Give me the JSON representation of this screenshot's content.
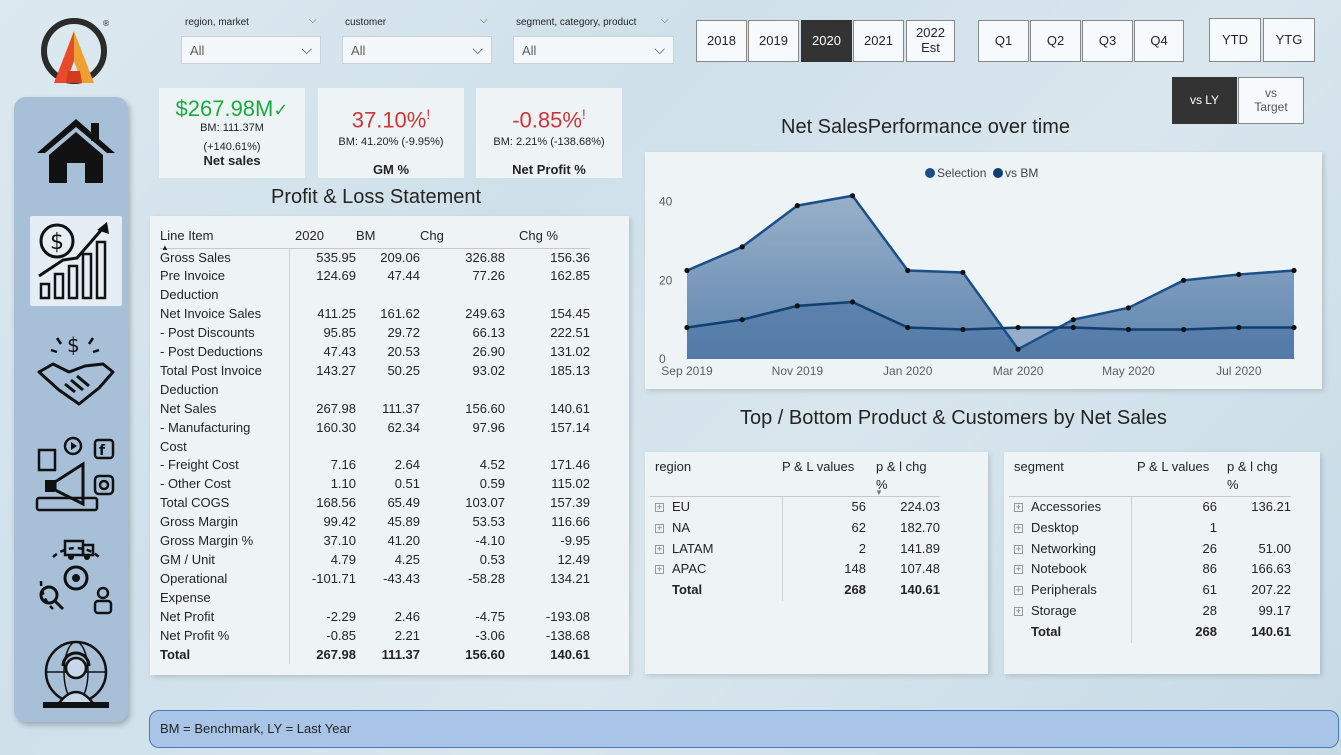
{
  "filters": {
    "region": {
      "label": "region, market",
      "value": "All"
    },
    "customer": {
      "label": "customer",
      "value": "All"
    },
    "segment": {
      "label": "segment, category, product",
      "value": "All"
    }
  },
  "years": [
    {
      "label": "2018",
      "sub": ""
    },
    {
      "label": "2019",
      "sub": ""
    },
    {
      "label": "2020",
      "sub": ""
    },
    {
      "label": "2021",
      "sub": ""
    },
    {
      "label": "2022",
      "sub": "Est"
    }
  ],
  "quarters": [
    "Q1",
    "Q2",
    "Q3",
    "Q4"
  ],
  "periods": [
    "YTD",
    "YTG"
  ],
  "compare": {
    "vs_ly": "vs LY",
    "vs_target_1": "vs",
    "vs_target_2": "Target"
  },
  "kpis": {
    "net_sales": {
      "value": "$267.98M",
      "mark": "✓",
      "bm": "BM: 111.37M",
      "chg": "(+140.61%)",
      "label": "Net sales"
    },
    "gm": {
      "value": "37.10%",
      "mark": "!",
      "bm": "BM: 41.20% (-9.95%)",
      "label": "GM %"
    },
    "np": {
      "value": "-0.85%",
      "mark": "!",
      "bm": "BM: 2.21% (-138.68%)",
      "label": "Net Profit %"
    }
  },
  "titles": {
    "pl": "Profit & Loss Statement",
    "chart": "Net SalesPerformance over time",
    "topbottom": "Top / Bottom Product & Customers by Net Sales"
  },
  "pl": {
    "headers": [
      "Line Item",
      "2020",
      "BM",
      "Chg",
      "Chg %"
    ],
    "rows": [
      {
        "l1": "Gross Sales",
        "l2": "",
        "v": [
          "535.95",
          "209.06",
          "326.88",
          "156.36"
        ]
      },
      {
        "l1": "Pre Invoice",
        "l2": "Deduction",
        "v": [
          "124.69",
          "47.44",
          "77.26",
          "162.85"
        ]
      },
      {
        "l1": "Net Invoice Sales",
        "l2": "",
        "v": [
          "411.25",
          "161.62",
          "249.63",
          "154.45"
        ]
      },
      {
        "l1": "- Post Discounts",
        "l2": "",
        "v": [
          "95.85",
          "29.72",
          "66.13",
          "222.51"
        ]
      },
      {
        "l1": "- Post Deductions",
        "l2": "",
        "v": [
          "47.43",
          "20.53",
          "26.90",
          "131.02"
        ]
      },
      {
        "l1": "Total Post Invoice",
        "l2": "Deduction",
        "v": [
          "143.27",
          "50.25",
          "93.02",
          "185.13"
        ]
      },
      {
        "l1": "Net Sales",
        "l2": "",
        "v": [
          "267.98",
          "111.37",
          "156.60",
          "140.61"
        ]
      },
      {
        "l1": "- Manufacturing",
        "l2": "Cost",
        "v": [
          "160.30",
          "62.34",
          "97.96",
          "157.14"
        ]
      },
      {
        "l1": "- Freight Cost",
        "l2": "",
        "v": [
          "7.16",
          "2.64",
          "4.52",
          "171.46"
        ]
      },
      {
        "l1": "- Other Cost",
        "l2": "",
        "v": [
          "1.10",
          "0.51",
          "0.59",
          "115.02"
        ]
      },
      {
        "l1": "Total COGS",
        "l2": "",
        "v": [
          "168.56",
          "65.49",
          "103.07",
          "157.39"
        ]
      },
      {
        "l1": "Gross Margin",
        "l2": "",
        "v": [
          "99.42",
          "45.89",
          "53.53",
          "116.66"
        ]
      },
      {
        "l1": "Gross Margin %",
        "l2": "",
        "v": [
          "37.10",
          "41.20",
          "-4.10",
          "-9.95"
        ]
      },
      {
        "l1": "GM / Unit",
        "l2": "",
        "v": [
          "4.79",
          "4.25",
          "0.53",
          "12.49"
        ]
      },
      {
        "l1": "Operational",
        "l2": "Expense",
        "v": [
          "-101.71",
          "-43.43",
          "-58.28",
          "134.21"
        ]
      },
      {
        "l1": "Net Profit",
        "l2": "",
        "v": [
          "-2.29",
          "2.46",
          "-4.75",
          "-193.08"
        ]
      },
      {
        "l1": "Net Profit %",
        "l2": "",
        "v": [
          "-0.85",
          "2.21",
          "-3.06",
          "-138.68"
        ]
      }
    ],
    "total": {
      "label": "Total",
      "v": [
        "267.98",
        "111.37",
        "156.60",
        "140.61"
      ]
    }
  },
  "chart_data": {
    "type": "area",
    "title": "Net SalesPerformance over time",
    "legend": [
      "Selection",
      "vs BM"
    ],
    "legend_position": "top-center",
    "x": [
      "Sep 2019",
      "Oct 2019",
      "Nov 2019",
      "Dec 2019",
      "Jan 2020",
      "Feb 2020",
      "Mar 2020",
      "Apr 2020",
      "May 2020",
      "Jun 2020",
      "Jul 2020",
      "Aug 2020"
    ],
    "x_tick_labels": [
      "Sep 2019",
      "Nov 2019",
      "Jan 2020",
      "Mar 2020",
      "May 2020",
      "Jul 2020"
    ],
    "y_ticks": [
      0,
      20,
      40
    ],
    "ylim": [
      0,
      45
    ],
    "series": [
      {
        "name": "Selection",
        "values": [
          22.5,
          28.5,
          39,
          41.5,
          22.5,
          22,
          2.5,
          10,
          13,
          20,
          21.5,
          22.5
        ]
      },
      {
        "name": "vs BM",
        "values": [
          8,
          10,
          13.5,
          14.5,
          8,
          7.5,
          8,
          8,
          7.5,
          7.5,
          8,
          8
        ]
      }
    ],
    "colors": {
      "selection": "#1a4f8a",
      "bm": "#0f3e70",
      "fill_top": "#8fa9c4",
      "fill_bottom": "#4f79a8"
    }
  },
  "region_table": {
    "headers": [
      "region",
      "P & L values",
      "p & l chg",
      "%"
    ],
    "rows": [
      {
        "name": "EU",
        "v1": "56",
        "v2": "224.03"
      },
      {
        "name": "NA",
        "v1": "62",
        "v2": "182.70"
      },
      {
        "name": "LATAM",
        "v1": "2",
        "v2": "141.89"
      },
      {
        "name": "APAC",
        "v1": "148",
        "v2": "107.48"
      }
    ],
    "total": {
      "name": "Total",
      "v1": "268",
      "v2": "140.61"
    }
  },
  "segment_table": {
    "headers": [
      "segment",
      "P & L values",
      "p & l chg",
      "%"
    ],
    "rows": [
      {
        "name": "Accessories",
        "v1": "66",
        "v2": "136.21"
      },
      {
        "name": "Desktop",
        "v1": "1",
        "v2": ""
      },
      {
        "name": "Networking",
        "v1": "26",
        "v2": "51.00"
      },
      {
        "name": "Notebook",
        "v1": "86",
        "v2": "166.63"
      },
      {
        "name": "Peripherals",
        "v1": "61",
        "v2": "207.22"
      },
      {
        "name": "Storage",
        "v1": "28",
        "v2": "99.17"
      }
    ],
    "total": {
      "name": "Total",
      "v1": "268",
      "v2": "140.61"
    }
  },
  "footer": "BM = Benchmark, LY = Last Year",
  "colors": {
    "accent_active": "#333333",
    "green": "#1aab40",
    "red": "#d13438",
    "sidebar": "#a8bfd8"
  }
}
